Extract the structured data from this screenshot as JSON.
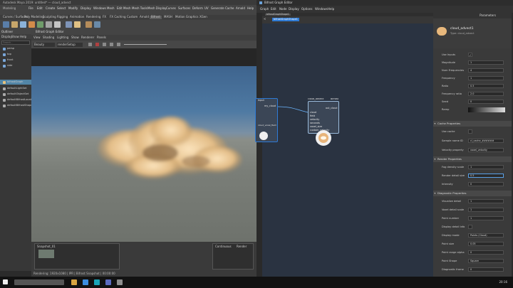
{
  "maya": {
    "title": "Autodesk Maya 2019: untitled* --- cloud_advect",
    "menus": [
      "Modeling",
      "File",
      "Edit",
      "Create",
      "Select",
      "Modify",
      "Display",
      "Windows",
      "Mesh",
      "Edit Mesh",
      "Mesh Tools",
      "Mesh Display",
      "Curves",
      "Surfaces",
      "Deform",
      "UV",
      "Generate",
      "Cache",
      "Arnold",
      "Help"
    ],
    "tabs": [
      "Curves / Surfaces",
      "Poly Modeling",
      "Sculpting",
      "Rigging",
      "Animation",
      "Rendering",
      "FX",
      "FX Caching",
      "Custom",
      "Arnold",
      "Bifrost",
      "MASH",
      "Motion Graphics",
      "XGen"
    ],
    "active_tab": "Bifrost",
    "outliner_title": "Outliner",
    "outliner_menu": [
      "Display",
      "Show",
      "Help"
    ],
    "outliner_search_placeholder": "Search...",
    "outliner_items": [
      "persp",
      "top",
      "front",
      "side",
      "bifrostGraph",
      "defaultLightSet",
      "defaultObjectSet",
      "defaultBifrostLocator",
      "defaultBifrostShape"
    ],
    "outliner_selected_index": 4,
    "viewport_title": "Bifrost Graph Editor",
    "viewport_menu": [
      "View",
      "Shading",
      "Lighting",
      "Show",
      "Renderer",
      "Panels"
    ],
    "viewport_toolbar": [
      "Beauty",
      "renderSetup"
    ],
    "snapshot_label": "Snapshot_01",
    "right_panel_tabs": [
      "Continuous",
      "Render"
    ],
    "status": "Rendering: 1920x1080 | IPR | Bifrost Snapshot | 00:00:00"
  },
  "bifrost": {
    "title": "Bifrost Graph Editor",
    "menus": [
      "Graph",
      "Edit",
      "Node",
      "Display",
      "Options",
      "Windows",
      "Help"
    ],
    "tab_label": "bifrostGraphShape1",
    "breadcrumb": "bifrostGraphShape1",
    "node_left": {
      "title": "Input",
      "port": "my_cloud",
      "labels": [
        "cloud_voxel_field"
      ]
    },
    "node_main": {
      "title": "cloud_advect",
      "badge": "Bifrost",
      "out_port": "out_cloud",
      "ports": [
        "cloud",
        "field",
        "velocity",
        "seconds",
        "voxel_size",
        "custom_velocity"
      ]
    }
  },
  "properties": {
    "header": "Parameters",
    "node_name": "cloud_advect1",
    "node_type": "Type: cloud_advect",
    "rows": [
      {
        "label": "Use Inputs",
        "kind": "check",
        "value": "✓"
      },
      {
        "label": "Magnitude",
        "kind": "field",
        "value": "1"
      },
      {
        "label": "Num Frequencies",
        "kind": "field",
        "value": "4"
      },
      {
        "label": "Frequency",
        "kind": "field",
        "value": "1"
      },
      {
        "label": "Ratio",
        "kind": "field",
        "value": "0.5"
      },
      {
        "label": "Frequency ratio",
        "kind": "field",
        "value": "2.0"
      },
      {
        "label": "Seed",
        "kind": "field",
        "value": "0"
      },
      {
        "label": "Ramp",
        "kind": "ramp",
        "value": ""
      }
    ],
    "section_cache": "Cache Properties",
    "cache_rows": [
      {
        "label": "Use cache",
        "kind": "check",
        "value": ""
      },
      {
        "label": "Sample name ID",
        "kind": "field",
        "value": "cl_cache_######"
      },
      {
        "label": "Velocity property",
        "kind": "field",
        "value": "voxel_velocity"
      }
    ],
    "section_render": "Render Properties",
    "render_rows": [
      {
        "label": "Fog density scale",
        "kind": "field",
        "value": "1"
      },
      {
        "label": "Render detail size",
        "kind": "field",
        "value": "0.5"
      },
      {
        "label": "Intensity",
        "kind": "field",
        "value": "0"
      }
    ],
    "section_diag": "Diagnostic Properties",
    "diag_rows": [
      {
        "label": "Visualize detail",
        "kind": "field",
        "value": "1"
      },
      {
        "label": "Voxel detail scale",
        "kind": "field",
        "value": "1"
      },
      {
        "label": "Point number",
        "kind": "field",
        "value": "1"
      },
      {
        "label": "Display detail info",
        "kind": "check",
        "value": ""
      },
      {
        "label": "Display mode",
        "kind": "select",
        "value": "Points (Cloud)"
      },
      {
        "label": "Point size",
        "kind": "field",
        "value": "0.05"
      },
      {
        "label": "Point range alpha",
        "kind": "field",
        "value": "0"
      },
      {
        "label": "Point Shape",
        "kind": "select",
        "value": "Square"
      },
      {
        "label": "Diagnostic frame",
        "kind": "field",
        "value": "0"
      }
    ]
  },
  "taskbar": {
    "time": "20:16"
  }
}
